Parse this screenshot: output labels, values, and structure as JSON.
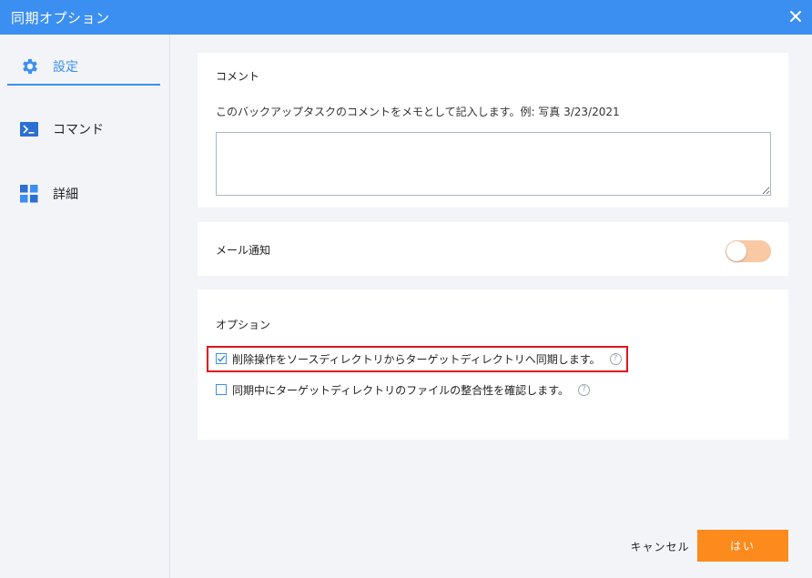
{
  "window": {
    "title": "同期オプション"
  },
  "sidebar": {
    "items": [
      {
        "label": "設定",
        "icon": "gear-icon",
        "active": true
      },
      {
        "label": "コマンド",
        "icon": "terminal-icon",
        "active": false
      },
      {
        "label": "詳細",
        "icon": "grid-icon",
        "active": false
      }
    ]
  },
  "comment": {
    "heading": "コメント",
    "description": "このバックアップタスクのコメントをメモとして記入します。例: 写真 3/23/2021",
    "value": ""
  },
  "mail": {
    "label": "メール通知",
    "enabled": false
  },
  "options": {
    "heading": "オプション",
    "items": [
      {
        "label": "削除操作をソースディレクトリからターゲットディレクトリへ同期します。",
        "checked": true,
        "help": "?"
      },
      {
        "label": "同期中にターゲットディレクトリのファイルの整合性を確認します。",
        "checked": false,
        "help": "?"
      }
    ]
  },
  "footer": {
    "cancel_label": "キャンセル",
    "ok_label": "はい"
  },
  "colors": {
    "accent": "#3b8ff0",
    "primary_button": "#fd8a1d",
    "highlight": "#e0141c",
    "toggle_off": "#f8c9a4"
  }
}
